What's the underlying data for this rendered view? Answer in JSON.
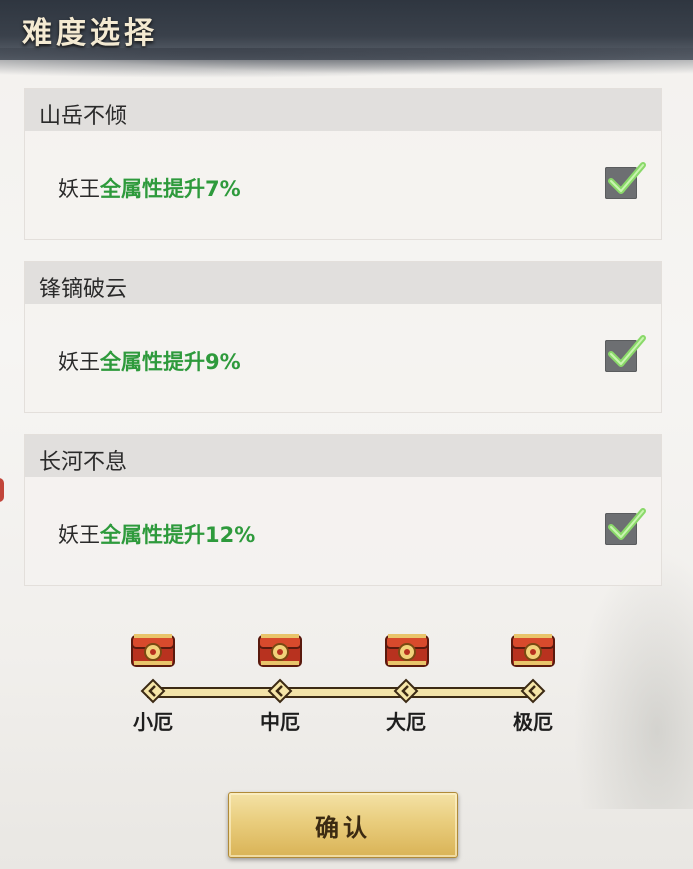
{
  "window": {
    "title": "难度选择"
  },
  "cards": [
    {
      "name": "山岳不倾",
      "desc_prefix": "妖王",
      "desc_effect": "全属性提升7%",
      "checked": true
    },
    {
      "name": "锋镝破云",
      "desc_prefix": "妖王",
      "desc_effect": "全属性提升9%",
      "checked": true
    },
    {
      "name": "长河不息",
      "desc_prefix": "妖王",
      "desc_effect": "全属性提升12%",
      "checked": true
    }
  ],
  "levels": [
    {
      "label": "小厄",
      "icon": "chest-icon"
    },
    {
      "label": "中厄",
      "icon": "chest-icon"
    },
    {
      "label": "大厄",
      "icon": "chest-icon"
    },
    {
      "label": "极厄",
      "icon": "chest-icon"
    }
  ],
  "confirm_button": {
    "label": "确认"
  },
  "colors": {
    "accent_green": "#2e9a3c",
    "button_gold": "#e9cd7d",
    "track": "#f3e3a8"
  }
}
